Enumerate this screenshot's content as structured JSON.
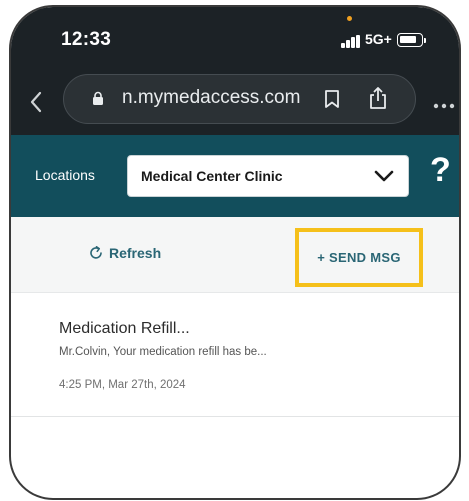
{
  "status_bar": {
    "time": "12:33",
    "network": "5G+",
    "battery_level_percent": 82
  },
  "browser": {
    "url": "n.mymedaccess.com",
    "icons": [
      "back-icon",
      "lock-icon",
      "bookmark-icon",
      "share-icon",
      "more-icon"
    ]
  },
  "header": {
    "locations_label": "Locations",
    "selected_location": "Medical Center Clinic",
    "help_label": "?"
  },
  "toolbar": {
    "refresh_label": "Refresh",
    "send_label": "+ SEND MSG"
  },
  "messages": [
    {
      "title": "Medication Refill...",
      "preview": "Mr.Colvin, Your medication refill has be...",
      "time": "4:25 PM, Mar 27th, 2024"
    }
  ],
  "colors": {
    "chrome_bg": "#1c2226",
    "header_bg": "#124e5c",
    "accent_text": "#2a6675",
    "highlight": "#f5c01a"
  }
}
